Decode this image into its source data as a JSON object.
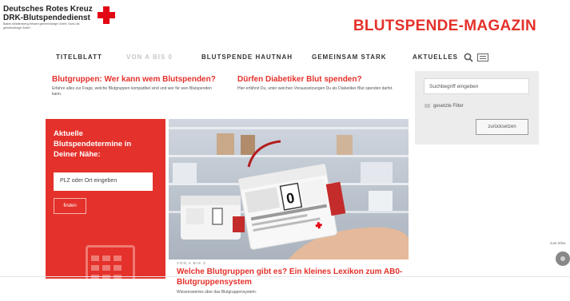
{
  "header": {
    "logo_line1": "Deutsches Rotes Kreuz",
    "logo_line2": "DRK-Blutspendedienst",
    "logo_small": "Baden-Württemberg-Hessen gemeinnützige GmbH, Nord-Ost gemeinnützige GmbH",
    "magazine_title": "BLUTSPENDE-MAGAZIN",
    "brand_color": "#e4312b"
  },
  "nav": {
    "items": [
      {
        "label": "TITELBLATT"
      },
      {
        "label": "VON A BIS 0"
      },
      {
        "label": "BLUTSPENDE HAUTNAH"
      },
      {
        "label": "GEMEINSAM STARK"
      },
      {
        "label": "AKTUELLES"
      }
    ],
    "search_icon": "search-icon",
    "menu_icon": "menu-icon"
  },
  "articles": [
    {
      "title": "Blutgruppen: Wer kann wem Blutspenden?",
      "text": "Erfahre alles zur Frage, welche Blutgruppen kompatibel sind und wer für wen Blutspenden kann."
    },
    {
      "title": "Dürfen Diabetiker Blut spenden?",
      "text": "Hier erfährst Du, unter welchen Voraussetzungen Du als Diabetiker Blut spenden darfst."
    }
  ],
  "sidebar": {
    "search_placeholder": "Suchbegriff eingeben",
    "filter_label": "gesetzte Filter",
    "reset_label": "zurücksetzen"
  },
  "appointments": {
    "title": "Aktuelle Blutspendetermine in Deiner Nähe:",
    "input_placeholder": "PLZ oder Ort eingeben",
    "button_label": "finden"
  },
  "featured": {
    "kicker": "VON A BIS 0",
    "title": "Welche Blutgruppen gibt es? Ein kleines Lexikon zum AB0-Blutgruppensystem",
    "text": "Wissenswertes über das Blutgruppensystem."
  },
  "side_tab": "zum Infos"
}
